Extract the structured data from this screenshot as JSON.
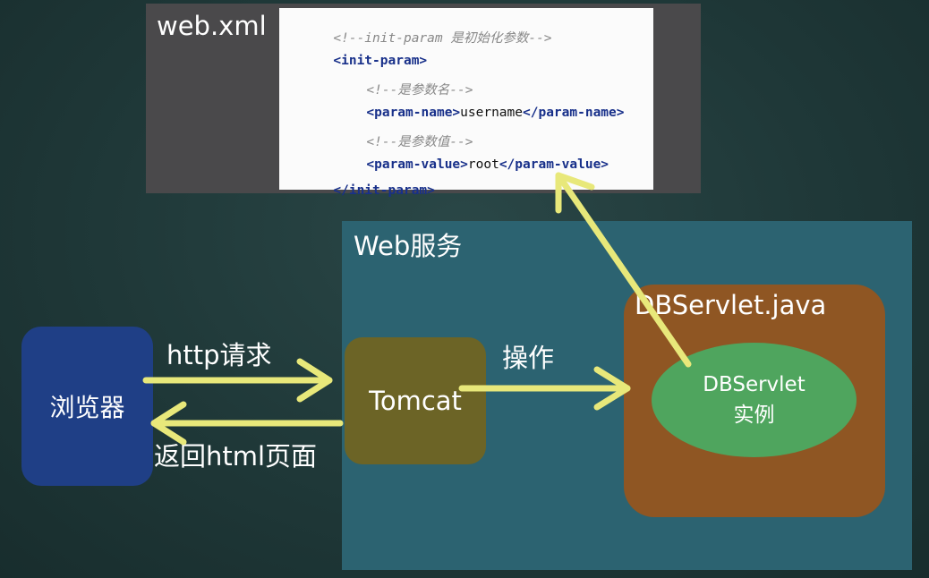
{
  "xml_panel": {
    "title": "web.xml",
    "lines": [
      {
        "comment": "<!--init-param 是初始化参数-->"
      },
      {
        "open": "<init-param>"
      },
      {
        "comment": "<!--是参数名-->"
      },
      {
        "open": "<param-name>",
        "text": "username",
        "close": "</param-name>"
      },
      {
        "comment": "<!--是参数值-->"
      },
      {
        "open": "<param-value>",
        "text": "root",
        "close": "</param-value>"
      },
      {
        "close_only": "</init-param>"
      }
    ]
  },
  "web_service": {
    "title": "Web服务"
  },
  "browser": {
    "label": "浏览器"
  },
  "tomcat": {
    "label": "Tomcat"
  },
  "servlet": {
    "title": "DBServlet.java",
    "instance_line1": "DBServlet",
    "instance_line2": "实例"
  },
  "arrows": {
    "request_label": "http请求",
    "response_label": "返回html页面",
    "operate_label": "操作"
  },
  "colors": {
    "arrow": "#e8e87a",
    "browser": "#1f3f86",
    "tomcat": "#6c6426",
    "servlet_box": "#8f5623",
    "instance": "#4fa55e",
    "web_panel": "#2c6371"
  }
}
